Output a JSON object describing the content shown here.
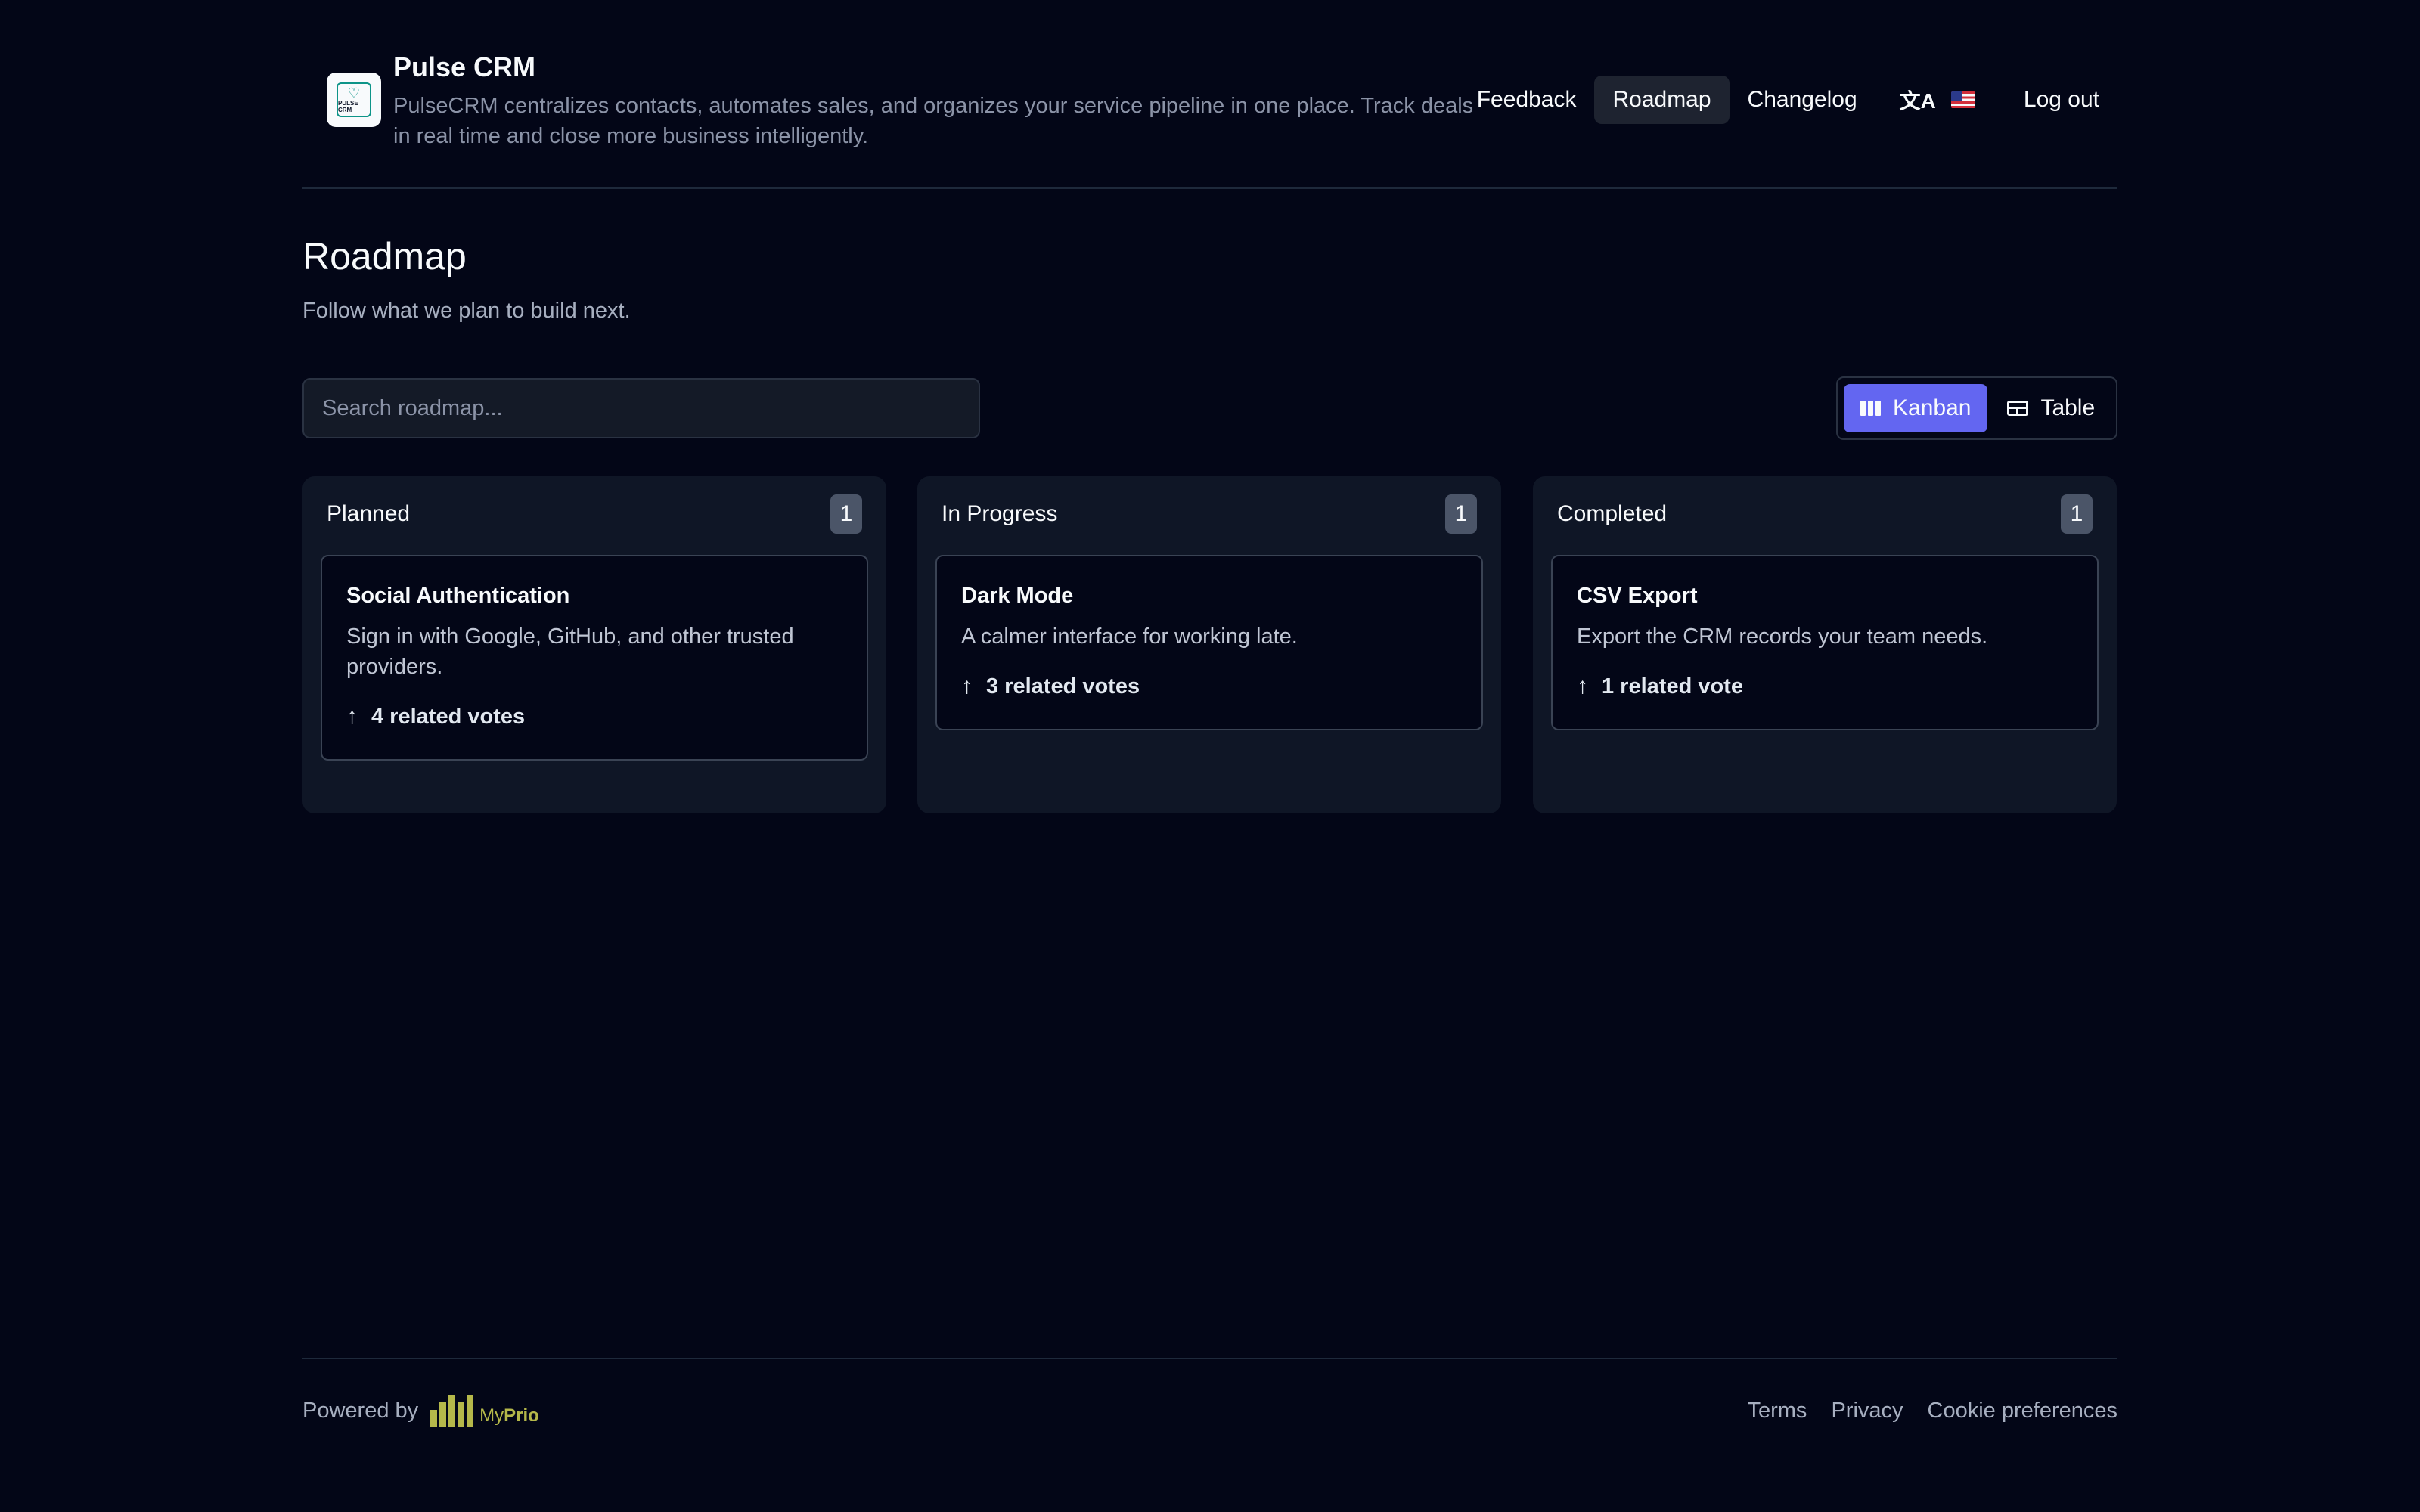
{
  "header": {
    "logo_icon": "pulse-crm-logo",
    "logo_text": "PULSE CRM",
    "brand_name": "Pulse CRM",
    "description": "PulseCRM centralizes contacts, automates sales, and organizes your service pipeline in one place. Track deals in real time and close more business intelligently.",
    "nav": [
      {
        "label": "Feedback",
        "active": false
      },
      {
        "label": "Roadmap",
        "active": true
      },
      {
        "label": "Changelog",
        "active": false
      }
    ],
    "language": {
      "icon": "translate-icon",
      "flag": "us-flag-icon"
    },
    "logout_label": "Log out"
  },
  "page": {
    "title": "Roadmap",
    "subtitle": "Follow what we plan to build next."
  },
  "search": {
    "placeholder": "Search roadmap...",
    "value": ""
  },
  "view_toggle": {
    "kanban_label": "Kanban",
    "table_label": "Table",
    "selected": "Kanban"
  },
  "columns": [
    {
      "title": "Planned",
      "count": "1",
      "card": {
        "title": "Social Authentication",
        "description": "Sign in with Google, GitHub, and other trusted providers.",
        "votes": "4 related votes"
      }
    },
    {
      "title": "In Progress",
      "count": "1",
      "card": {
        "title": "Dark Mode",
        "description": "A calmer interface for working late.",
        "votes": "3 related votes"
      }
    },
    {
      "title": "Completed",
      "count": "1",
      "card": {
        "title": "CSV Export",
        "description": "Export the CRM records your team needs.",
        "votes": "1 related vote"
      }
    }
  ],
  "footer": {
    "powered_by": "Powered by",
    "brand_my": "My",
    "brand_prio": "Prio",
    "links": [
      "Terms",
      "Privacy",
      "Cookie preferences"
    ]
  },
  "colors": {
    "background": "#030617",
    "accent": "#6366f1",
    "column_bg": "#0f1626",
    "brand_logo": "#b5b84a"
  }
}
